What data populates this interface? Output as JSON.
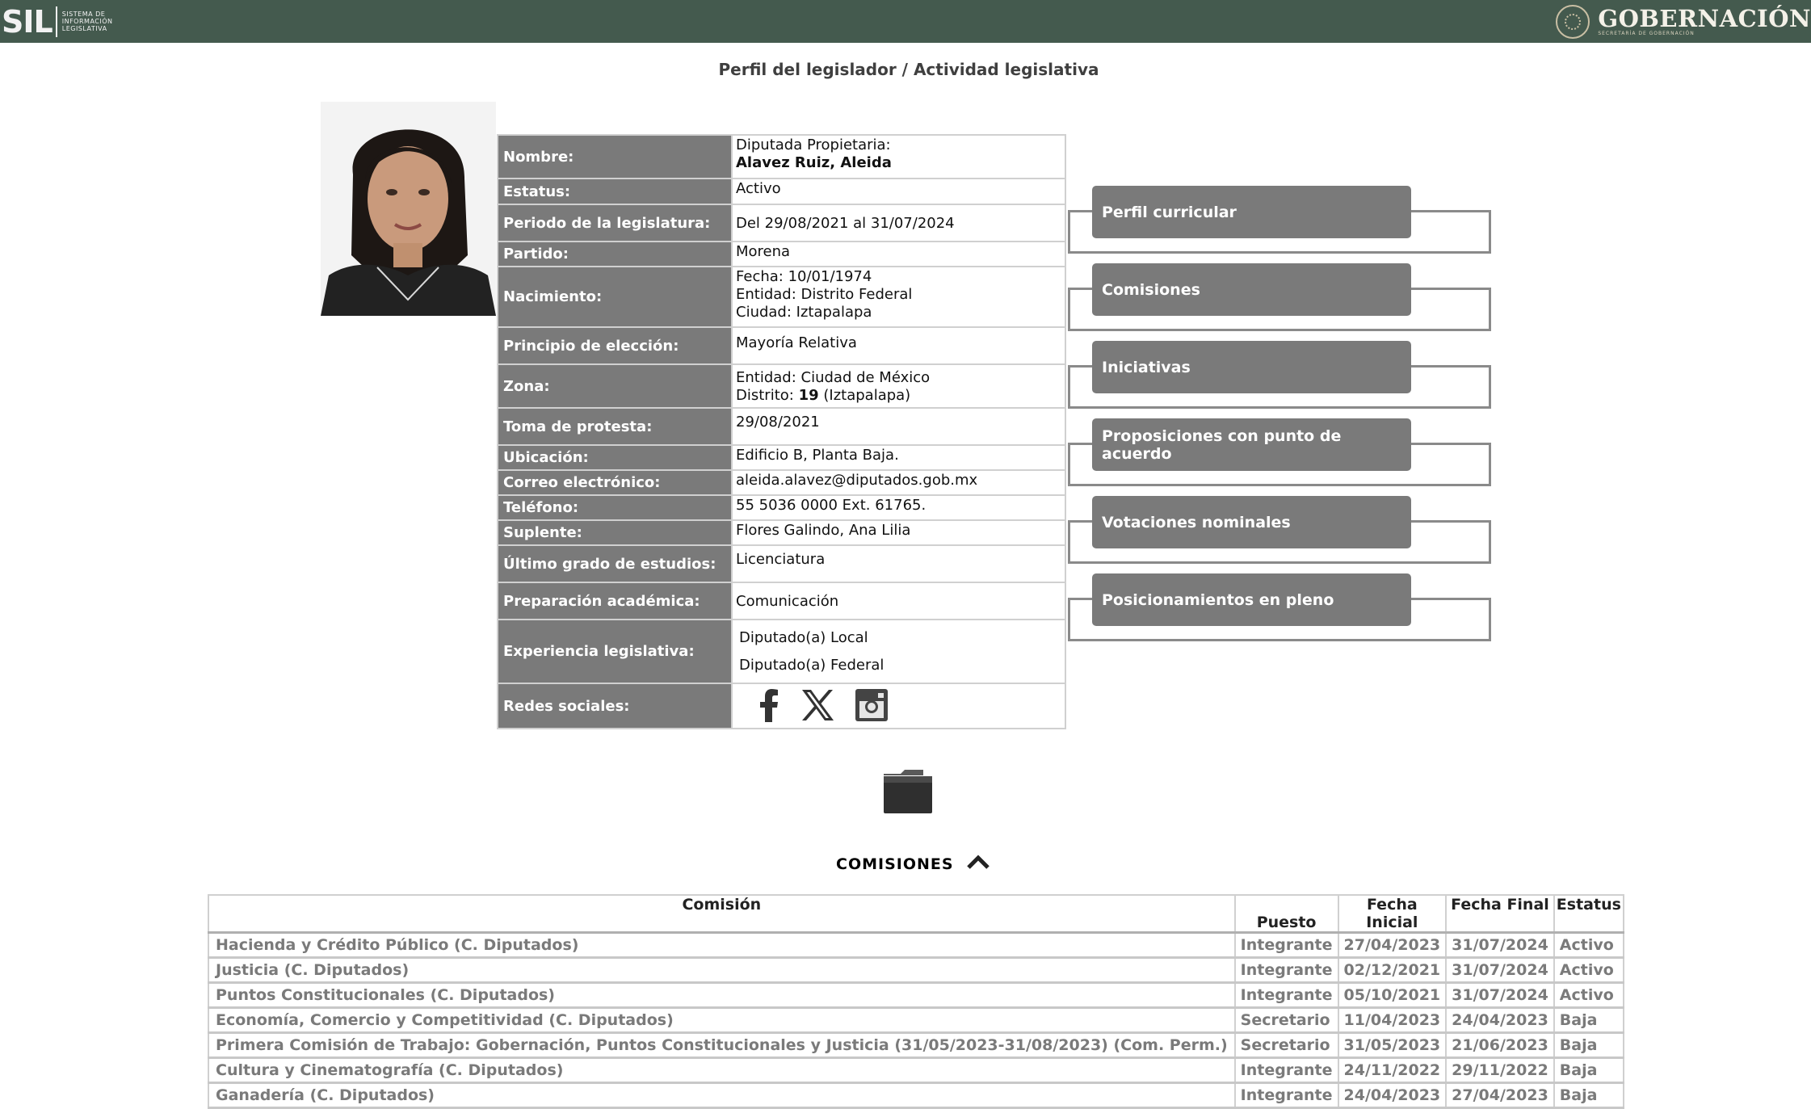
{
  "header": {
    "sil_logo_text": "SIL",
    "sil_logo_subtitle": "SISTEMA DE INFORMACIÓN LEGISLATIVA",
    "gob_text": "GOBERNACIÓN",
    "gob_subtitle": "SECRETARÍA DE GOBERNACIÓN"
  },
  "page_title": "Perfil del legislador / Actividad legislativa",
  "profile": {
    "nombre_label": "Nombre:",
    "nombre_line1": "Diputada Propietaria:",
    "nombre_line2": "Alavez Ruiz, Aleida",
    "estatus_label": "Estatus:",
    "estatus": "Activo",
    "periodo_label": "Periodo de la legislatura:",
    "periodo": "Del 29/08/2021 al 31/07/2024",
    "partido_label": "Partido:",
    "partido": "Morena",
    "nacimiento_label": "Nacimiento:",
    "nacimiento_fecha": "Fecha: 10/01/1974",
    "nacimiento_entidad": "Entidad: Distrito Federal",
    "nacimiento_ciudad": "Ciudad: Iztapalapa",
    "principio_label": "Principio de elección:",
    "principio": "Mayoría Relativa",
    "zona_label": "Zona:",
    "zona_entidad": "Entidad: Ciudad de México",
    "zona_distrito_prefix": "Distrito:",
    "zona_distrito_num": "19",
    "zona_distrito_suffix": "(Iztapalapa)",
    "toma_label": "Toma de protesta:",
    "toma": "29/08/2021",
    "ubicacion_label": "Ubicación:",
    "ubicacion": "Edificio B, Planta Baja.",
    "correo_label": "Correo electrónico:",
    "correo": "aleida.alavez@diputados.gob.mx",
    "telefono_label": "Teléfono:",
    "telefono": "55 5036 0000 Ext. 61765.",
    "suplente_label": "Suplente:",
    "suplente": "Flores Galindo, Ana Lilia",
    "grado_label": "Último grado de estudios:",
    "grado": "Licenciatura",
    "preparacion_label": "Preparación académica:",
    "preparacion": "Comunicación",
    "experiencia_label": "Experiencia legislativa:",
    "experiencia": [
      "Diputado(a) Local",
      "Diputado(a) Federal"
    ],
    "redes_label": "Redes sociales:"
  },
  "menu": [
    "Perfil curricular",
    "Comisiones",
    "Iniciativas",
    "Proposiciones con punto de acuerdo",
    "Votaciones nominales",
    "Posicionamientos en pleno"
  ],
  "comisiones": {
    "heading": "COMISIONES",
    "columns": [
      "Comisión",
      "Puesto",
      "Fecha Inicial",
      "Fecha Final",
      "Estatus"
    ],
    "rows": [
      [
        "Hacienda y Crédito Público (C. Diputados)",
        "Integrante",
        "27/04/2023",
        "31/07/2024",
        "Activo"
      ],
      [
        "Justicia (C. Diputados)",
        "Integrante",
        "02/12/2021",
        "31/07/2024",
        "Activo"
      ],
      [
        "Puntos Constitucionales (C. Diputados)",
        "Integrante",
        "05/10/2021",
        "31/07/2024",
        "Activo"
      ],
      [
        "Economía, Comercio y Competitividad (C. Diputados)",
        "Secretario",
        "11/04/2023",
        "24/04/2023",
        "Baja"
      ],
      [
        "Primera Comisión de Trabajo: Gobernación, Puntos Constitucionales y Justicia (31/05/2023-31/08/2023) (Com. Perm.)",
        "Secretario",
        "31/05/2023",
        "21/06/2023",
        "Baja"
      ],
      [
        "Cultura y Cinematografía (C. Diputados)",
        "Integrante",
        "24/11/2022",
        "29/11/2022",
        "Baja"
      ],
      [
        "Ganadería (C. Diputados)",
        "Integrante",
        "24/04/2023",
        "27/04/2023",
        "Baja"
      ]
    ]
  },
  "icons": {
    "facebook": "facebook-icon",
    "x": "x-icon",
    "instagram": "instagram-icon",
    "folder": "folder-icon",
    "collapse": "chevron-up-icon"
  },
  "colors": {
    "header_bg": "#445a4e",
    "label_bg": "#7a7a7a",
    "menu_btn_bg": "#7a7a7a"
  }
}
